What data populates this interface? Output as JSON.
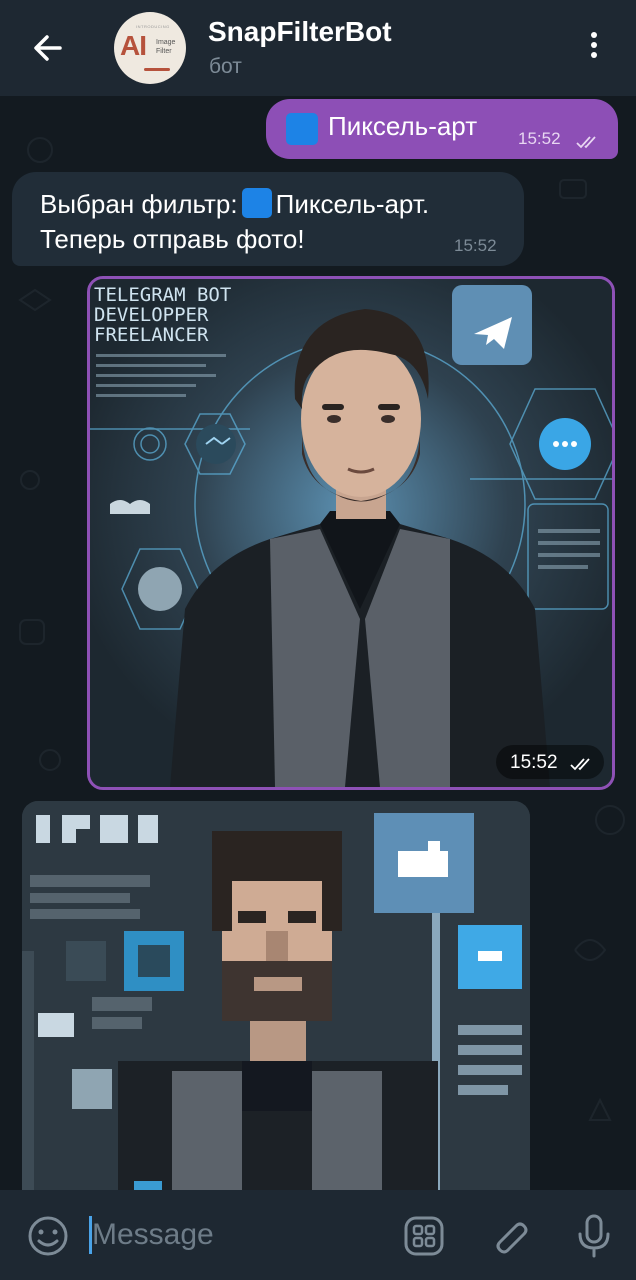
{
  "header": {
    "back_icon": "arrow-left-icon",
    "avatar": {
      "logo_text": "AI",
      "logo_tagline": "INTRODUCING",
      "logo_sub1": "Image",
      "logo_sub2": "Filter"
    },
    "title": "SnapFilterBot",
    "subtitle": "бот",
    "menu_icon": "more-vertical-icon"
  },
  "messages": [
    {
      "direction": "out",
      "emoji": "blue-square",
      "text": "Пиксель-арт",
      "time": "15:52",
      "status": "read"
    },
    {
      "direction": "in",
      "line1_prefix": "Выбран фильтр:",
      "emoji": "blue-square",
      "line1_suffix": "Пиксель-арт.",
      "line2": "Теперь отправь фото!",
      "time": "15:52"
    },
    {
      "direction": "out",
      "type": "photo",
      "overlay_title": [
        "TELEGRAM BOT",
        "DEVELOPPER",
        "FREELANCER"
      ],
      "time": "15:52",
      "status": "read"
    },
    {
      "direction": "in",
      "type": "photo",
      "filter": "pixel-art"
    }
  ],
  "composer": {
    "emoji_icon": "smile-icon",
    "placeholder": "Message",
    "commands_icon": "bot-commands-icon",
    "attach_icon": "paperclip-icon",
    "mic_icon": "microphone-icon"
  },
  "colors": {
    "header_bg": "#1e2832",
    "chat_bg": "#131a20",
    "outgoing_bubble": "#8d4fb6",
    "incoming_bubble": "#212d38",
    "accent": "#4aa3e8",
    "emoji_blue": "#1d83e6"
  }
}
